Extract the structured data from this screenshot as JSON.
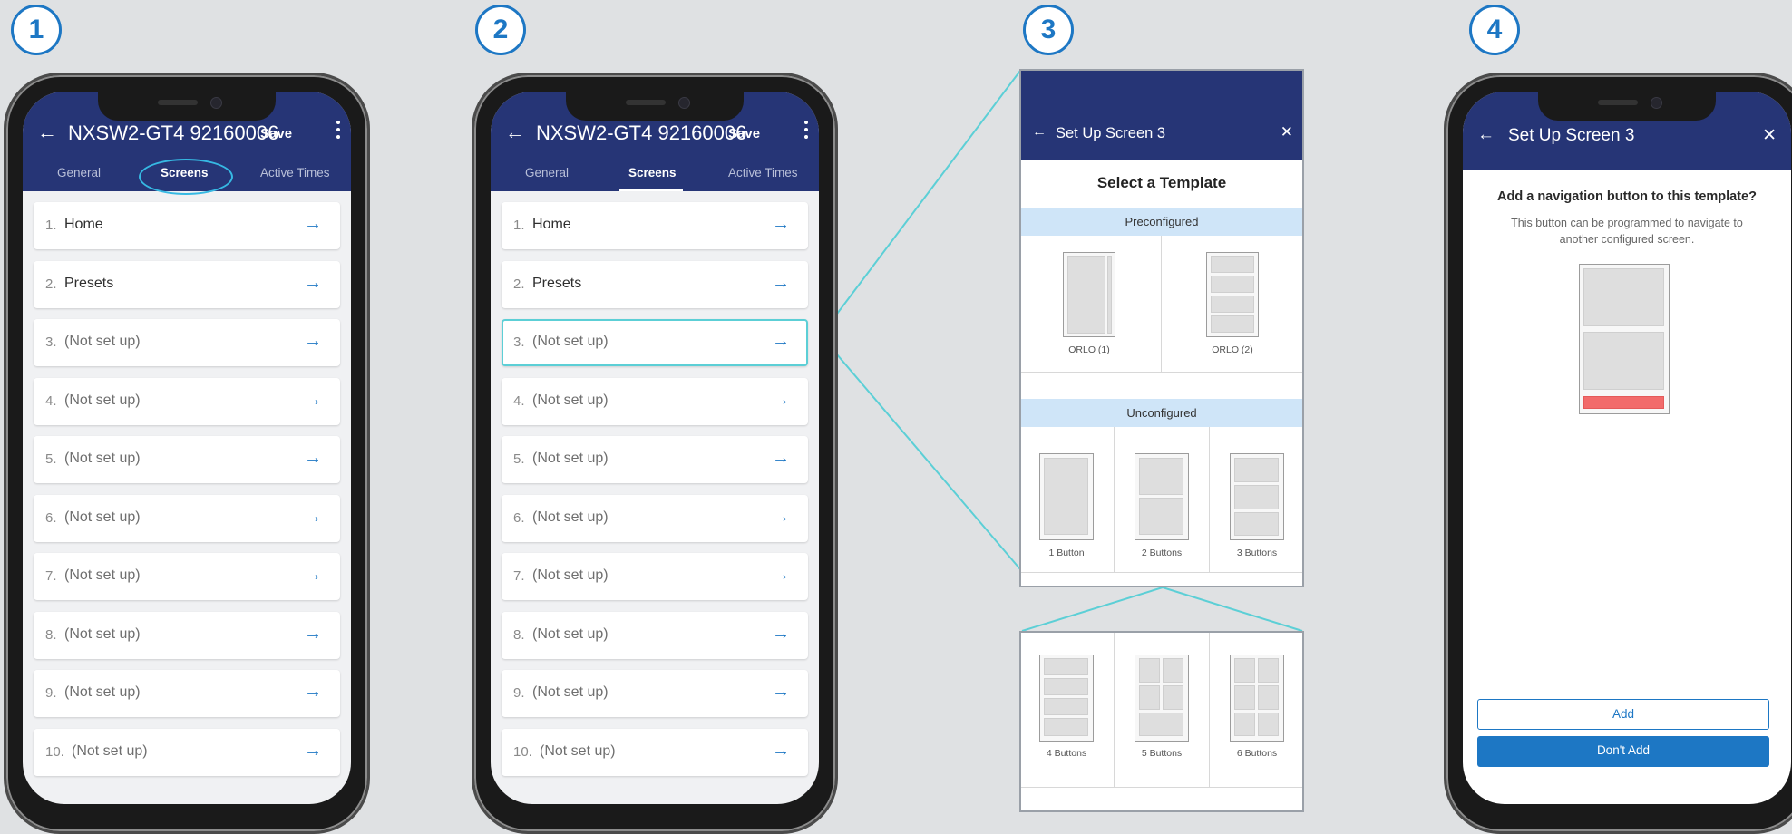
{
  "steps": [
    "1",
    "2",
    "3",
    "4"
  ],
  "panel1": {
    "title": "NXSW2-GT4 92160006",
    "save": "Save",
    "tabs": [
      "General",
      "Screens",
      "Active Times"
    ],
    "items": [
      {
        "num": "1.",
        "label": "Home"
      },
      {
        "num": "2.",
        "label": "Presets"
      },
      {
        "num": "3.",
        "label": "(Not set up)"
      },
      {
        "num": "4.",
        "label": "(Not set up)"
      },
      {
        "num": "5.",
        "label": "(Not set up)"
      },
      {
        "num": "6.",
        "label": "(Not set up)"
      },
      {
        "num": "7.",
        "label": "(Not set up)"
      },
      {
        "num": "8.",
        "label": "(Not set up)"
      },
      {
        "num": "9.",
        "label": "(Not set up)"
      },
      {
        "num": "10.",
        "label": "(Not set up)"
      }
    ]
  },
  "panel2": {
    "title": "NXSW2-GT4 92160006",
    "save": "Save",
    "tabs": [
      "General",
      "Screens",
      "Active Times"
    ],
    "items": [
      {
        "num": "1.",
        "label": "Home"
      },
      {
        "num": "2.",
        "label": "Presets"
      },
      {
        "num": "3.",
        "label": "(Not set up)"
      },
      {
        "num": "4.",
        "label": "(Not set up)"
      },
      {
        "num": "5.",
        "label": "(Not set up)"
      },
      {
        "num": "6.",
        "label": "(Not set up)"
      },
      {
        "num": "7.",
        "label": "(Not set up)"
      },
      {
        "num": "8.",
        "label": "(Not set up)"
      },
      {
        "num": "9.",
        "label": "(Not set up)"
      },
      {
        "num": "10.",
        "label": "(Not set up)"
      }
    ]
  },
  "panel3": {
    "title": "Set Up Screen 3",
    "heading": "Select a Template",
    "preconfigured": "Preconfigured",
    "unconfigured": "Unconfigured",
    "orlo1": "ORLO (1)",
    "orlo2": "ORLO (2)",
    "b1": "1 Button",
    "b2": "2 Buttons",
    "b3": "3 Buttons",
    "b4": "4 Buttons",
    "b5": "5 Buttons",
    "b6": "6 Buttons"
  },
  "panel4": {
    "title": "Set Up Screen 3",
    "question": "Add a navigation button to this template?",
    "desc1": "This button can be programmed to navigate to",
    "desc2": "another configured screen.",
    "add": "Add",
    "dont_add": "Don't Add",
    "accent": "#f26b6b"
  },
  "colors": {
    "appbar": "#263576",
    "accent": "#1d77c4",
    "highlight": "#5ccfd6"
  }
}
